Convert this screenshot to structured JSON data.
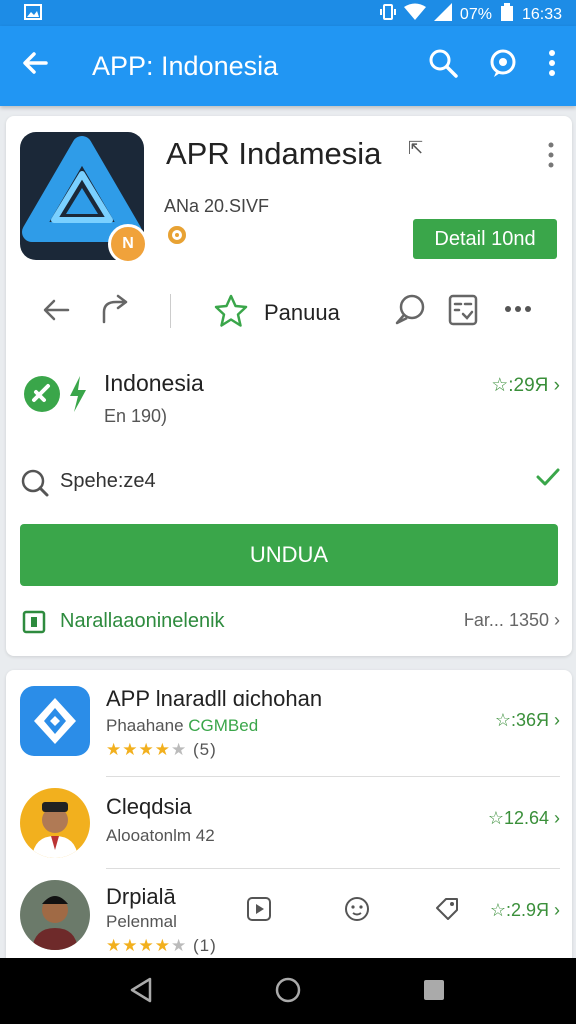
{
  "status": {
    "battery": "07%",
    "time": "16:33"
  },
  "appbar": {
    "title": "APP: Indonesia"
  },
  "app": {
    "title": "APR Indamesia",
    "subtitle": "ANa 20.SIVF",
    "badge": "N",
    "detail_button": "Detail 10nd",
    "favorite_label": "Panuua"
  },
  "indonesia_row": {
    "title": "Indonesia",
    "subtitle": "En 190)",
    "rating": "☆:29Я"
  },
  "search_row": {
    "text": "Spehe:ze4"
  },
  "main_button": "UNDUA",
  "link_row": {
    "text": "Narallaaoninelenik",
    "right": "Ꮀar...",
    "count": "1350"
  },
  "list": [
    {
      "title": "APP lnaradll ɑichohan",
      "sub_a": "Phaahane",
      "sub_b": "CGMBed",
      "stars": 4,
      "count": "(5)",
      "rating": "☆:36Я"
    },
    {
      "title": "Cleqdsia",
      "sub": "Alooatonlm 42",
      "rating": "☆12.64"
    },
    {
      "title": "Drpialā",
      "sub": "Pelenmal",
      "stars": 4,
      "count": "(1)",
      "rating": "☆:2.9Я"
    }
  ],
  "colors": {
    "primary": "#2196f3",
    "accent_green": "#3aa64a",
    "link_green": "#2e8b3e",
    "star": "#f2b01e",
    "badge_orange": "#f0a23b"
  }
}
